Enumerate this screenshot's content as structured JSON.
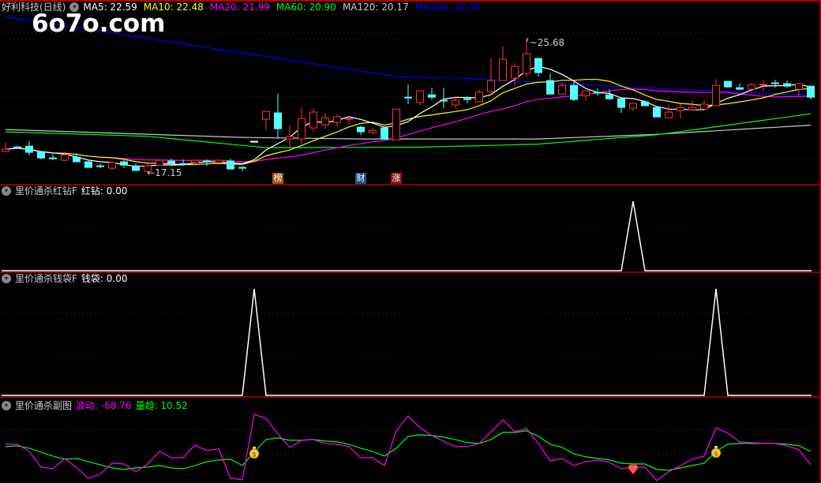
{
  "stock": {
    "title": "好利科技(日线)"
  },
  "watermark": "6o7o.com",
  "ma_labels": [
    {
      "key": "MA5",
      "text": "MA5: 22.59",
      "color": "#ffffff"
    },
    {
      "key": "MA10",
      "text": "MA10: 22.48",
      "color": "#ffff00"
    },
    {
      "key": "MA20",
      "text": "MA20: 21.99",
      "color": "#ff00ff"
    },
    {
      "key": "MA60",
      "text": "MA60: 20.90",
      "color": "#00ff00"
    },
    {
      "key": "MA120",
      "text": "MA120: 20.17",
      "color": "#c8c8c8"
    },
    {
      "key": "MA250",
      "text": "MA250: 22.10",
      "color": "#0000ff"
    }
  ],
  "annotations": {
    "high": "25.68",
    "low": "17.15"
  },
  "event_tags": [
    {
      "text": "榜",
      "index": 23,
      "color": "#a0521e"
    },
    {
      "text": "财",
      "index": 30,
      "color": "#1e4f86"
    },
    {
      "text": "涨",
      "index": 33,
      "color": "#8a1515"
    }
  ],
  "panels": {
    "hongzuan": {
      "title": "里价通杀红钻F",
      "label": "红钻: 0.00",
      "signals": [
        53
      ]
    },
    "qiandai": {
      "title": "里价通杀钱袋F",
      "label": "钱袋: 0.00",
      "signals": [
        21,
        60
      ]
    },
    "fututu": {
      "title": "里价通杀副图",
      "label_wave": "波动: -68.76",
      "label_trend": "量趋: 10.52",
      "wave_color": "#ff00ff",
      "trend_color": "#00ff00",
      "bag_icons": [
        21,
        60
      ],
      "diamond_icons": [
        53
      ]
    }
  },
  "colors": {
    "up": "#ff3232",
    "down": "#54ffff",
    "grid": "#8a1a1a",
    "border": "#b00000"
  },
  "chart_data": {
    "type": "candlestick",
    "ylim": [
      16.39,
      27.36
    ],
    "candles": [
      [
        18.47,
        19.08,
        18.47,
        18.62
      ],
      [
        18.77,
        18.82,
        18.62,
        18.77
      ],
      [
        18.82,
        19.13,
        18.21,
        18.42
      ],
      [
        18.47,
        18.52,
        17.96,
        18.06
      ],
      [
        18.06,
        18.31,
        17.91,
        18.04
      ],
      [
        17.91,
        18.47,
        17.86,
        18.26
      ],
      [
        18.11,
        18.36,
        17.81,
        17.81
      ],
      [
        17.81,
        17.91,
        17.45,
        17.45
      ],
      [
        17.55,
        17.7,
        17.4,
        17.53
      ],
      [
        17.4,
        17.86,
        17.3,
        17.76
      ],
      [
        17.81,
        17.91,
        17.4,
        17.6
      ],
      [
        17.55,
        17.7,
        17.25,
        17.25
      ],
      [
        17.2,
        17.7,
        17.15,
        17.55
      ],
      [
        17.6,
        17.91,
        17.55,
        17.91
      ],
      [
        17.86,
        18.01,
        17.55,
        17.7
      ],
      [
        17.7,
        17.96,
        17.55,
        17.68
      ],
      [
        17.76,
        17.96,
        17.6,
        17.91
      ],
      [
        17.86,
        17.96,
        17.55,
        17.84
      ],
      [
        17.76,
        17.91,
        17.7,
        17.91
      ],
      [
        17.86,
        18.01,
        17.3,
        17.35
      ],
      [
        17.45,
        17.55,
        17.2,
        17.43
      ],
      [
        19.13,
        19.13,
        19.13,
        19.13
      ],
      [
        20.55,
        21.06,
        19.84,
        21.06
      ],
      [
        20.96,
        22.22,
        19.28,
        19.94
      ],
      [
        19.28,
        20.14,
        18.67,
        19.43
      ],
      [
        19.28,
        21.31,
        18.92,
        20.6
      ],
      [
        19.99,
        21.26,
        19.74,
        21.01
      ],
      [
        20.19,
        20.96,
        19.94,
        20.65
      ],
      [
        20.35,
        20.86,
        20.09,
        20.7
      ],
      [
        20.58,
        20.75,
        20.24,
        20.6
      ],
      [
        20.04,
        20.14,
        19.53,
        19.74
      ],
      [
        19.69,
        19.99,
        19.58,
        19.84
      ],
      [
        19.99,
        20.09,
        19.23,
        19.28
      ],
      [
        19.23,
        21.21,
        19.23,
        21.21
      ],
      [
        21.97,
        22.78,
        21.52,
        21.92
      ],
      [
        21.62,
        22.38,
        21.47,
        22.38
      ],
      [
        22.12,
        22.58,
        21.82,
        21.97
      ],
      [
        21.77,
        22.58,
        21.26,
        21.75
      ],
      [
        21.47,
        22.02,
        21.26,
        21.77
      ],
      [
        21.87,
        22.02,
        21.57,
        21.85
      ],
      [
        21.67,
        22.48,
        21.67,
        22.28
      ],
      [
        22.33,
        24.51,
        22.12,
        23.04
      ],
      [
        23.04,
        25.27,
        23.04,
        24.41
      ],
      [
        23.19,
        24.16,
        22.73,
        23.95
      ],
      [
        23.5,
        25.68,
        23.29,
        24.77
      ],
      [
        24.46,
        24.51,
        23.29,
        23.55
      ],
      [
        23.04,
        23.5,
        22.17,
        22.17
      ],
      [
        22.17,
        22.89,
        22.17,
        22.73
      ],
      [
        22.73,
        22.99,
        21.72,
        21.82
      ],
      [
        22.07,
        22.38,
        21.77,
        22.38
      ],
      [
        22.28,
        22.53,
        22.07,
        22.26
      ],
      [
        22.12,
        22.48,
        21.77,
        21.87
      ],
      [
        21.87,
        21.97,
        20.96,
        21.31
      ],
      [
        21.26,
        21.57,
        21.06,
        21.57
      ],
      [
        21.67,
        21.77,
        21.42,
        21.42
      ],
      [
        21.31,
        21.36,
        20.7,
        20.7
      ],
      [
        20.65,
        21.47,
        20.65,
        21.01
      ],
      [
        21.11,
        21.52,
        20.6,
        21.31
      ],
      [
        21.16,
        21.77,
        21.16,
        21.31
      ],
      [
        21.21,
        21.77,
        21.16,
        21.52
      ],
      [
        21.42,
        23.14,
        21.42,
        22.73
      ],
      [
        22.99,
        22.99,
        22.58,
        22.63
      ],
      [
        22.58,
        22.84,
        22.43,
        22.48
      ],
      [
        22.48,
        22.89,
        22.48,
        22.78
      ],
      [
        22.77,
        23.09,
        22.33,
        22.79
      ],
      [
        22.89,
        23.09,
        22.58,
        22.87
      ],
      [
        22.84,
        23.04,
        22.58,
        22.68
      ],
      [
        22.48,
        22.84,
        21.97,
        22.84
      ],
      [
        22.68,
        22.68,
        21.82,
        21.97
      ]
    ],
    "ma_long": {
      "MA60": [
        [
          0,
          19.74
        ],
        [
          12,
          19.45
        ],
        [
          22,
          18.72
        ],
        [
          35,
          18.75
        ],
        [
          45,
          18.95
        ],
        [
          55,
          19.55
        ],
        [
          68,
          20.9
        ]
      ],
      "MA120": [
        [
          0,
          19.89
        ],
        [
          20,
          19.38
        ],
        [
          30,
          19.28
        ],
        [
          45,
          19.28
        ],
        [
          55,
          19.58
        ],
        [
          68,
          20.17
        ]
      ],
      "MA250": [
        [
          0,
          27.15
        ],
        [
          33,
          23.3
        ],
        [
          40,
          23.14
        ],
        [
          53,
          22.6
        ],
        [
          68,
          22.1
        ]
      ]
    },
    "sub_ylim": [
      -172,
      323
    ],
    "wave": [
      52.5,
      52.5,
      10.5,
      -82.8,
      -92.1,
      -31.5,
      -87.4,
      -148.1,
      -124.7,
      -59.4,
      -64.1,
      -110.7,
      -64.1,
      10.5,
      -26.8,
      -26.8,
      47.8,
      15.2,
      24.5,
      -148.1,
      -157.4,
      229.7,
      206.4,
      113.1,
      33.8,
      75.8,
      80.5,
      57.2,
      52.5,
      38.5,
      -26.8,
      -26.8,
      -73.4,
      131.8,
      220.4,
      150.4,
      103.8,
      71.2,
      38.5,
      38.5,
      57.2,
      127.1,
      197.1,
      127.1,
      145.8,
      57.2,
      -45.5,
      -31.5,
      -73.4,
      -50.1,
      -40.8,
      -54.8,
      -92.1,
      -82.8,
      -82.8,
      -162.0,
      -110.7,
      -73.4,
      -36.1,
      -17.5,
      150.4,
      117.8,
      66.5,
      61.8,
      57.2,
      57.2,
      43.2,
      19.9,
      -68.76
    ],
    "trend": [
      38.5,
      43.2,
      29.2,
      5.9,
      -17.5,
      -36.1,
      -31.5,
      -50.1,
      -68.8,
      -87.4,
      -96.8,
      -87.4,
      -82.8,
      -73.4,
      -87.4,
      -92.1,
      -73.4,
      -50.1,
      -40.8,
      -36.1,
      -73.4,
      5.9,
      80.5,
      89.8,
      75.8,
      75.8,
      80.5,
      71.2,
      66.5,
      52.5,
      29.2,
      10.5,
      -17.5,
      29.2,
      99.1,
      108.5,
      103.8,
      94.5,
      80.5,
      61.8,
      57.2,
      80.5,
      122.5,
      122.5,
      131.8,
      99.1,
      52.5,
      33.8,
      -3.5,
      -22.1,
      -31.5,
      -40.8,
      -59.4,
      -64.1,
      -64.1,
      -96.8,
      -101.4,
      -87.4,
      -73.4,
      -59.4,
      10.5,
      52.5,
      57.2,
      57.2,
      57.2,
      57.2,
      52.5,
      43.2,
      10.52
    ]
  }
}
